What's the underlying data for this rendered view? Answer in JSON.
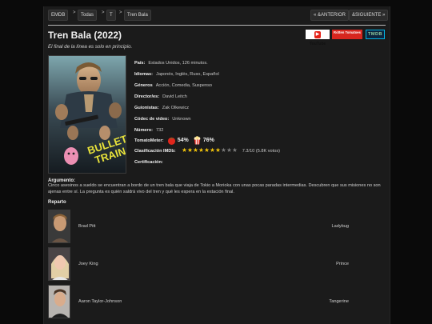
{
  "breadcrumbs": [
    "EMDB",
    "Todas",
    "T",
    "Tren Bala"
  ],
  "breadcrumb_separator": ">",
  "nav": {
    "prev": "« &ANTERIOR",
    "next": "&SIGUIENTE »"
  },
  "movie": {
    "title": "Tren Bala (2022)",
    "tagline": "El final de la línea es solo en principio."
  },
  "external_links": {
    "youtube": "YouTube",
    "rotten": "Rotten Tomatoes",
    "tmdb": "TMDB"
  },
  "poster": {
    "title_line1": "BULLET",
    "title_line2": "TRAIN",
    "accent_color": "#e8e23a"
  },
  "details": {
    "pais": {
      "label": "País:",
      "value": "Estados Unidos, 126 minutos."
    },
    "idiomas": {
      "label": "Idiomas:",
      "value": "Japonés, Inglés, Ruso, Español"
    },
    "generos": {
      "label": "Géneros",
      "value": "Acción, Comedia, Suspenso"
    },
    "director": {
      "label": "Director/es:",
      "value": "David Leitch"
    },
    "guionistas": {
      "label": "Guionistas:",
      "value": "Zak Olkewicz"
    },
    "codec": {
      "label": "Códec de video:",
      "value": "Unknown"
    },
    "numero": {
      "label": "Número:",
      "value": "732"
    },
    "tomatometer": {
      "label": "TomatoMeter:",
      "critics": "54%",
      "audience": "76%"
    },
    "imdb": {
      "label": "Clasificación IMDb:",
      "value": "7.3/10 (5.8K votos)",
      "rating": 7.3,
      "max": 10
    },
    "certificacion": {
      "label": "Certificación:",
      "value": ""
    }
  },
  "plot": {
    "label": "Argumento:",
    "text": "Cinco asesinos a sueldo se encuentran a bordo de un tren bala que viaja de Tokio a Morioka con unas pocas paradas intermedias. Descubren que sus misiones no son ajenas entre sí. La pregunta es quién saldrá vivo del tren y qué les espera en la estación final."
  },
  "cast": {
    "label": "Reparto",
    "members": [
      {
        "name": "Brad Pitt",
        "role": "Ladybug"
      },
      {
        "name": "Joey King",
        "role": "Prince"
      },
      {
        "name": "Aaron Taylor-Johnson",
        "role": "Tangerine"
      }
    ]
  },
  "colors": {
    "star_on": "#f2c40c",
    "star_off": "#7a7a7a",
    "youtube_red": "#e62117",
    "rotten_red": "#d7261e",
    "tmdb_bg": "#0d253f",
    "tmdb_accent": "#01b4e4"
  }
}
